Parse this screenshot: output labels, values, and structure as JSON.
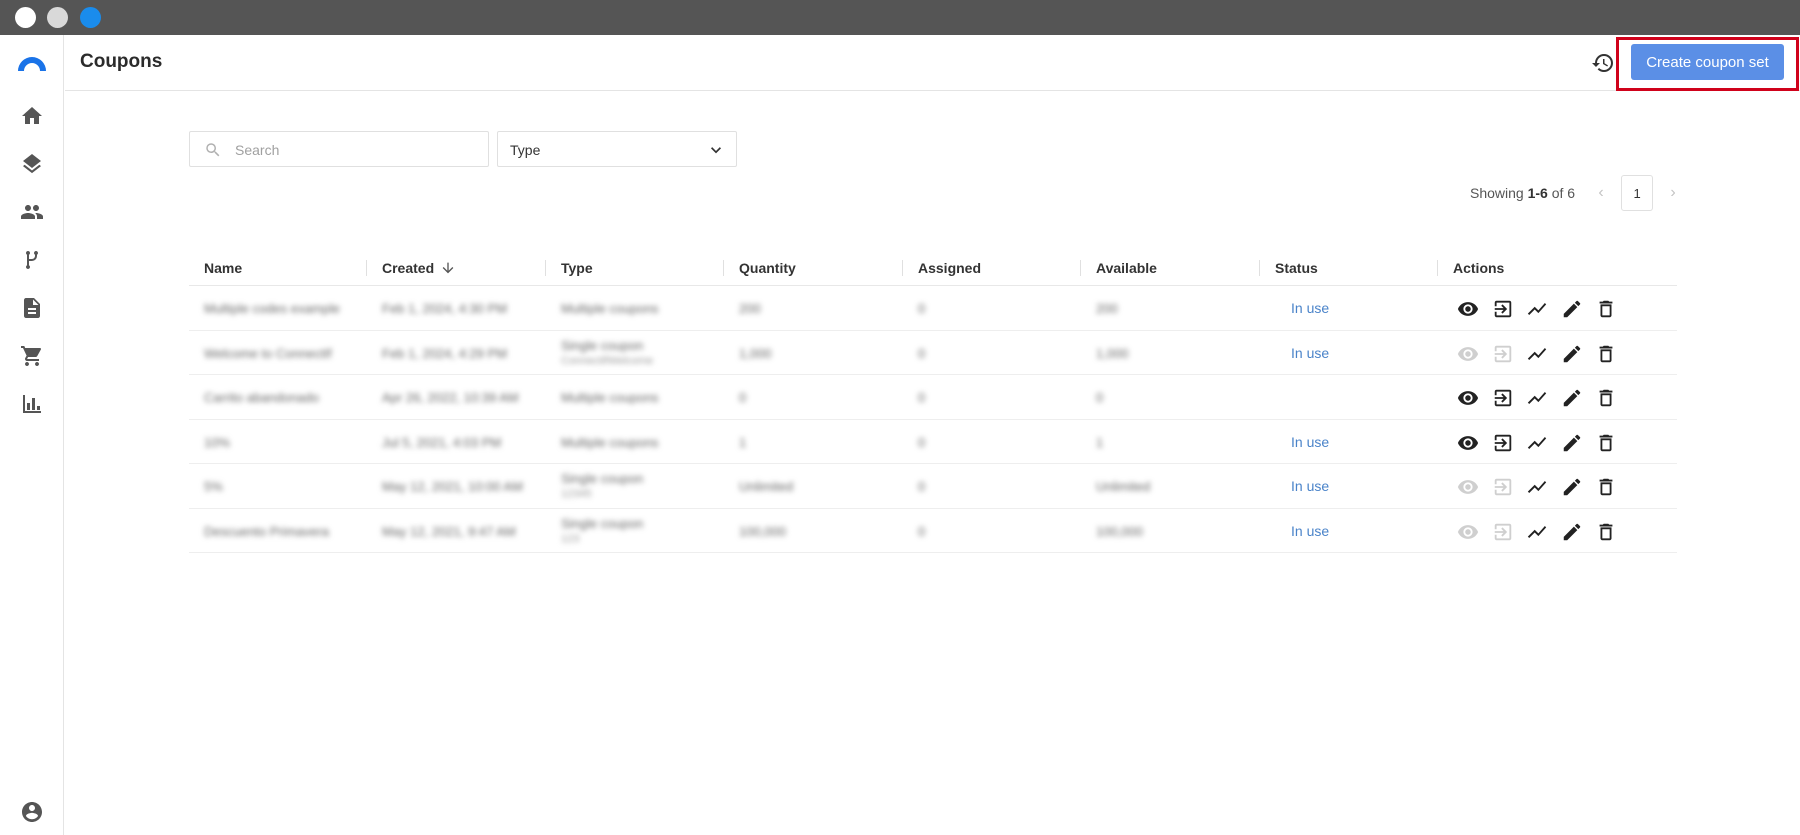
{
  "header": {
    "title": "Coupons",
    "create_label": "Create coupon set"
  },
  "filters": {
    "search_placeholder": "Search",
    "type_label": "Type"
  },
  "pagination": {
    "showing_prefix": "Showing ",
    "range": "1-6",
    "of_text": " of 6",
    "page": "1"
  },
  "table": {
    "columns": [
      "Name",
      "Created",
      "Type",
      "Quantity",
      "Assigned",
      "Available",
      "Status",
      "Actions"
    ],
    "rows": [
      {
        "name": "Multiple codes example",
        "created": "Feb 1, 2024, 4:30 PM",
        "type": "Multiple coupons",
        "type_sub": "",
        "quantity": "200",
        "assigned": "0",
        "available": "200",
        "status": "In use",
        "view_enabled": true
      },
      {
        "name": "Welcome to ConnectIf",
        "created": "Feb 1, 2024, 4:29 PM",
        "type": "Single coupon",
        "type_sub": "ConnectifWelcome",
        "quantity": "1,000",
        "assigned": "0",
        "available": "1,000",
        "status": "In use",
        "view_enabled": false
      },
      {
        "name": "Carrito abandonado",
        "created": "Apr 26, 2022, 10:39 AM",
        "type": "Multiple coupons",
        "type_sub": "",
        "quantity": "0",
        "assigned": "0",
        "available": "0",
        "status": "",
        "view_enabled": true
      },
      {
        "name": "10%",
        "created": "Jul 5, 2021, 4:03 PM",
        "type": "Multiple coupons",
        "type_sub": "",
        "quantity": "1",
        "assigned": "0",
        "available": "1",
        "status": "In use",
        "view_enabled": true
      },
      {
        "name": "5%",
        "created": "May 12, 2021, 10:00 AM",
        "type": "Single coupon",
        "type_sub": "12345",
        "quantity": "Unlimited",
        "assigned": "0",
        "available": "Unlimited",
        "status": "In use",
        "view_enabled": false
      },
      {
        "name": "Descuento Primavera",
        "created": "May 12, 2021, 9:47 AM",
        "type": "Single coupon",
        "type_sub": "123",
        "quantity": "100,000",
        "assigned": "0",
        "available": "100,000",
        "status": "In use",
        "view_enabled": false
      }
    ]
  },
  "colors": {
    "accent": "#5b8fe6",
    "status": "#4a83c9",
    "highlight": "#d0021b"
  },
  "icons": [
    "home-icon",
    "layers-icon",
    "people-icon",
    "workflow-icon",
    "document-icon",
    "cart-icon",
    "bar-chart-icon",
    "account-icon",
    "history-icon",
    "search-icon",
    "chevron-down-icon",
    "eye-icon",
    "export-icon",
    "trending-icon",
    "pencil-icon",
    "trash-icon"
  ]
}
